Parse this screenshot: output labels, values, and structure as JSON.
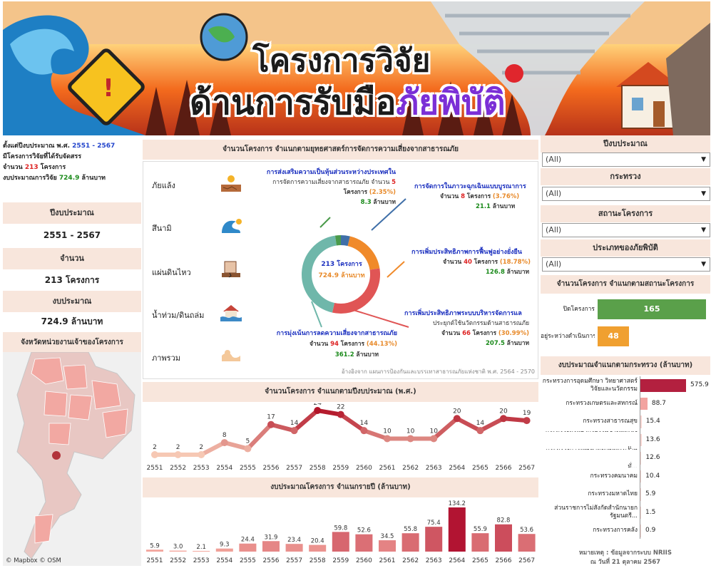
{
  "banner": {
    "title_line1": "โครงการวิจัย",
    "title_line2_main": "ด้านการรับมือ",
    "title_line2_accent": "ภัยพิบัติ"
  },
  "summary": {
    "line1_prefix": "ตั้งแต่ปีงบประมาณ พ.ศ. ",
    "line1_range": "2551 - 2567",
    "line2": "มีโครงการวิจัยที่ได้รับจัดสรร",
    "line3_prefix": "จำนวน ",
    "line3_count": "213",
    "line3_suffix": " โครงการ",
    "line4_prefix": "งบประมาณการวิจัย ",
    "line4_amount": "724.9",
    "line4_suffix": " ล้านบาท"
  },
  "kpis": [
    {
      "label": "ปีงบประมาณ",
      "value": "2551 - 2567"
    },
    {
      "label": "จำนวน",
      "value": "213 โครงการ"
    },
    {
      "label": "งบประมาณ",
      "value": "724.9 ล้านบาท"
    }
  ],
  "map": {
    "title": "จังหวัดหน่วยงานเจ้าของโครงการ",
    "credit": "© Mapbox  © OSM"
  },
  "strategy": {
    "title": "จำนวนโครงการ จำแนกตามยุทธศาสตร์การจัดการความเสี่ยงจากสาธารณภัย",
    "hazards": [
      {
        "label": "ภัยแล้ง",
        "icon": "drought-icon"
      },
      {
        "label": "สึนามิ",
        "icon": "tsunami-icon"
      },
      {
        "label": "แผ่นดินไหว",
        "icon": "earthquake-icon"
      },
      {
        "label": "น้ำท่วม/ดินถล่ม",
        "icon": "flood-icon"
      },
      {
        "label": "ภาพรวม",
        "icon": "overview-icon"
      }
    ],
    "center_count": "213 โครงการ",
    "center_budget": "724.9 ล้านบาท",
    "source": "อ้างอิงจาก แผนการป้องกันและบรรเทาสาธารณภัยแห่งชาติ พ.ศ. 2564 - 2570",
    "segments": [
      {
        "title": "การส่งเสริมความเป็นหุ้นส่วนระหว่างประเทศใน",
        "sub": "การจัดการความเสี่ยงจากสาธารณภัย จำนวน ",
        "count": "5",
        "unit": "โครงการ",
        "pct": "(2.35%)",
        "budget": "8.3",
        "budget_unit": "ล้านบาท",
        "color": "#4a9a4a",
        "value": 5
      },
      {
        "title": "การจัดการในภาวะฉุกเฉินแบบบูรณาการ",
        "sub": "จำนวน ",
        "count": "8",
        "unit": "โครงการ",
        "pct": "(3.76%)",
        "budget": "21.1",
        "budget_unit": "ล้านบาท",
        "color": "#3f6fa8",
        "value": 8
      },
      {
        "title": "การเพิ่มประสิทธิภาพการฟื้นฟูอย่างยั่งยืน",
        "sub": "จำนวน ",
        "count": "40",
        "unit": "โครงการ",
        "pct": "(18.78%)",
        "budget": "126.8",
        "budget_unit": "ล้านบาท",
        "color": "#f08a2a",
        "value": 40
      },
      {
        "title": "การเพิ่มประสิทธิภาพระบบบริหารจัดการแล",
        "sub": "ประยุกต์ใช้นวัตกรรมด้านสาธารณภัย",
        "sub2": "จำนวน ",
        "count": "66",
        "unit": "โครงการ",
        "pct": "(30.99%)",
        "budget": "207.5",
        "budget_unit": "ล้านบาท",
        "color": "#e05555",
        "value": 66
      },
      {
        "title": "การมุ่งเน้นการลดความเสี่ยงจากสาธารณภัย",
        "sub": "จำนวน ",
        "count": "94",
        "unit": "โครงการ",
        "pct": "(44.13%)",
        "budget": "361.2",
        "budget_unit": "ล้านบาท",
        "color": "#6fb7aa",
        "value": 94
      }
    ]
  },
  "chart_data": [
    {
      "type": "line",
      "title": "จำนวนโครงการ จำแนกตามปีงบประมาณ (พ.ศ.)",
      "x": [
        "2551",
        "2552",
        "2553",
        "2554",
        "2555",
        "2556",
        "2557",
        "2558",
        "2559",
        "2560",
        "2561",
        "2562",
        "2563",
        "2564",
        "2565",
        "2566",
        "2567"
      ],
      "values": [
        2,
        2,
        2,
        8,
        5,
        17,
        14,
        24,
        22,
        14,
        10,
        10,
        10,
        20,
        14,
        20,
        19
      ]
    },
    {
      "type": "bar",
      "title": "งบประมาณโครงการ จำแนกรายปี (ล้านบาท)",
      "categories": [
        "2551",
        "2552",
        "2553",
        "2554",
        "2555",
        "2556",
        "2557",
        "2558",
        "2559",
        "2560",
        "2561",
        "2562",
        "2563",
        "2564",
        "2565",
        "2566",
        "2567"
      ],
      "values": [
        5.9,
        3.0,
        2.1,
        9.3,
        24.4,
        31.9,
        23.4,
        20.4,
        59.8,
        52.6,
        34.5,
        55.8,
        75.4,
        134.2,
        55.9,
        82.8,
        53.6
      ],
      "labels": [
        "5.9",
        "3.0",
        "2.1",
        "9.3",
        "24.4",
        "31.9",
        "23.4",
        "20.4",
        "59.8",
        "52.6",
        "34.5",
        "55.8",
        "75.4",
        "134.2",
        "55.9",
        "82.8",
        "53.6"
      ]
    },
    {
      "type": "bar",
      "title": "จำนวนโครงการ จำแนกตามสถานะโครงการ",
      "categories": [
        "ปิดโครงการ",
        "อยู่ระหว่างดำเนินการ"
      ],
      "values": [
        165,
        48
      ],
      "colors": [
        "#5aa04a",
        "#f0a030"
      ]
    },
    {
      "type": "bar",
      "title": "งบประมาณจำแนกตามกระทรวง (ล้านบาท)",
      "categories": [
        "กระทรวงการอุดมศึกษา วิทยาศาสตร์ วิจัยและนวัตกรรม",
        "กระทรวงเกษตรและสหกรณ์",
        "กระทรวงสาธารณสุข",
        "กระทรวงทรัพยากรธรรมชาติและสิ่งแ...",
        "กระทรวงการพัฒนาสังคมและความมั่...",
        "กระทรวงคมนาคม",
        "กระทรวงมหาดไทย",
        "ส่วนราชการไม่สังกัดสำนักนายกรัฐมนตรี...",
        "กระทรวงการคลัง"
      ],
      "values": [
        575.9,
        88.7,
        15.4,
        13.6,
        12.6,
        10.4,
        5.9,
        1.5,
        0.9
      ],
      "labels": [
        "575.9",
        "88.7",
        "15.4",
        "13.6",
        "12.6",
        "10.4",
        "5.9",
        "1.5",
        "0.9"
      ]
    }
  ],
  "filters": [
    {
      "label": "ปีงบประมาณ",
      "value": "(All)"
    },
    {
      "label": "กระทรวง",
      "value": "(All)"
    },
    {
      "label": "สถานะโครงการ",
      "value": "(All)"
    },
    {
      "label": "ประเภทของภัยพิบัติ",
      "value": "(All)"
    }
  ],
  "footer_note_1": "หมายเหตุ : ข้อมูลจากระบบ NRIIS",
  "footer_note_2": "ณ วันที่ 21 ตุลาคม 2567"
}
